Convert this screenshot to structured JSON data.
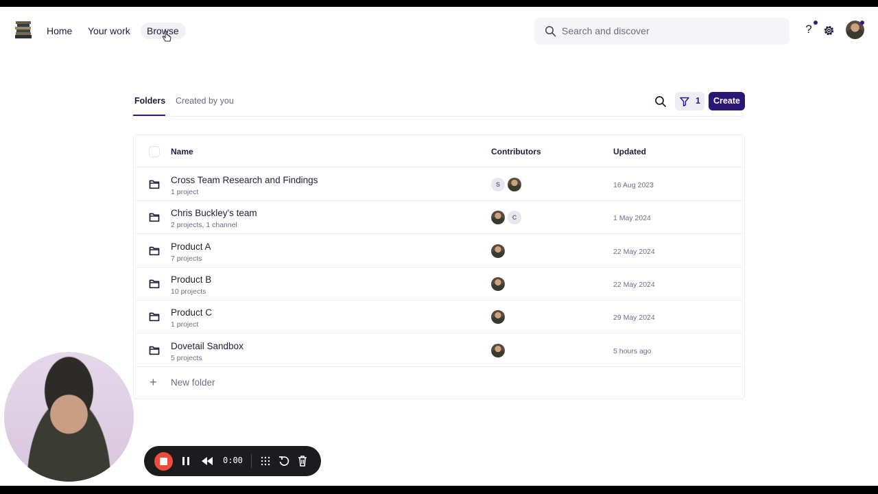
{
  "nav": {
    "home": "Home",
    "your_work": "Your work",
    "browse": "Browse",
    "search_placeholder": "Search and discover",
    "help": "?"
  },
  "tabs": [
    {
      "label": "Folders",
      "active": true
    },
    {
      "label": "Created by you",
      "active": false
    }
  ],
  "toolbar": {
    "filter_count": "1",
    "create_label": "Create"
  },
  "table": {
    "headers": {
      "name": "Name",
      "contributors": "Contributors",
      "updated": "Updated"
    },
    "rows": [
      {
        "name": "Cross Team Research and Findings",
        "sub": "1 project",
        "contributors": [
          "S",
          "photo"
        ],
        "updated": "16 Aug 2023"
      },
      {
        "name": "Chris Buckley's team",
        "sub": "2 projects, 1 channel",
        "contributors": [
          "photo",
          "C"
        ],
        "updated": "1 May 2024"
      },
      {
        "name": "Product A",
        "sub": "7 projects",
        "contributors": [
          "photo"
        ],
        "updated": "22 May 2024"
      },
      {
        "name": "Product B",
        "sub": "10 projects",
        "contributors": [
          "photo"
        ],
        "updated": "22 May 2024"
      },
      {
        "name": "Product C",
        "sub": "1 project",
        "contributors": [
          "photo"
        ],
        "updated": "29 May 2024"
      },
      {
        "name": "Dovetail Sandbox",
        "sub": "5 projects",
        "contributors": [
          "photo"
        ],
        "updated": "5 hours ago"
      }
    ],
    "new_folder": "New folder"
  },
  "recorder": {
    "time": "0:00"
  },
  "colors": {
    "accent": "#2a1673",
    "record": "#ee4b3a",
    "text": "#1f1b3a",
    "muted": "#6e6b80"
  }
}
